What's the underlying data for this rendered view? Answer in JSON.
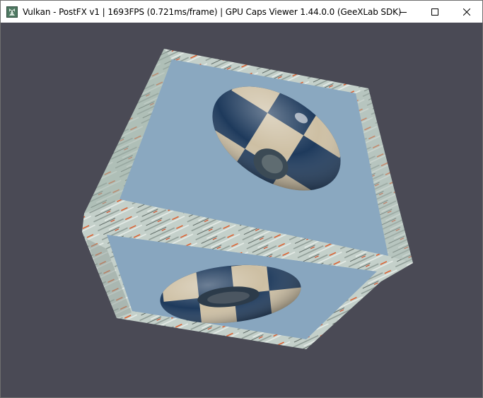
{
  "window": {
    "title": "Vulkan - PostFX v1 | 1693FPS (0.721ms/frame) | GPU Caps Viewer 1.44.0.0 (GeeXLab SDK)",
    "icon": "geexlab-app-icon"
  },
  "controls": {
    "minimize": "minimize-icon",
    "maximize": "maximize-icon",
    "close": "close-icon"
  },
  "scene": {
    "background_color": "#4a4a55",
    "face_color": "#8aa8c0",
    "frame_color": "#c7d3cd",
    "accent_color": "#e0521c",
    "torus_dark": "#1e3a5c",
    "torus_light": "#cdbfa3"
  }
}
